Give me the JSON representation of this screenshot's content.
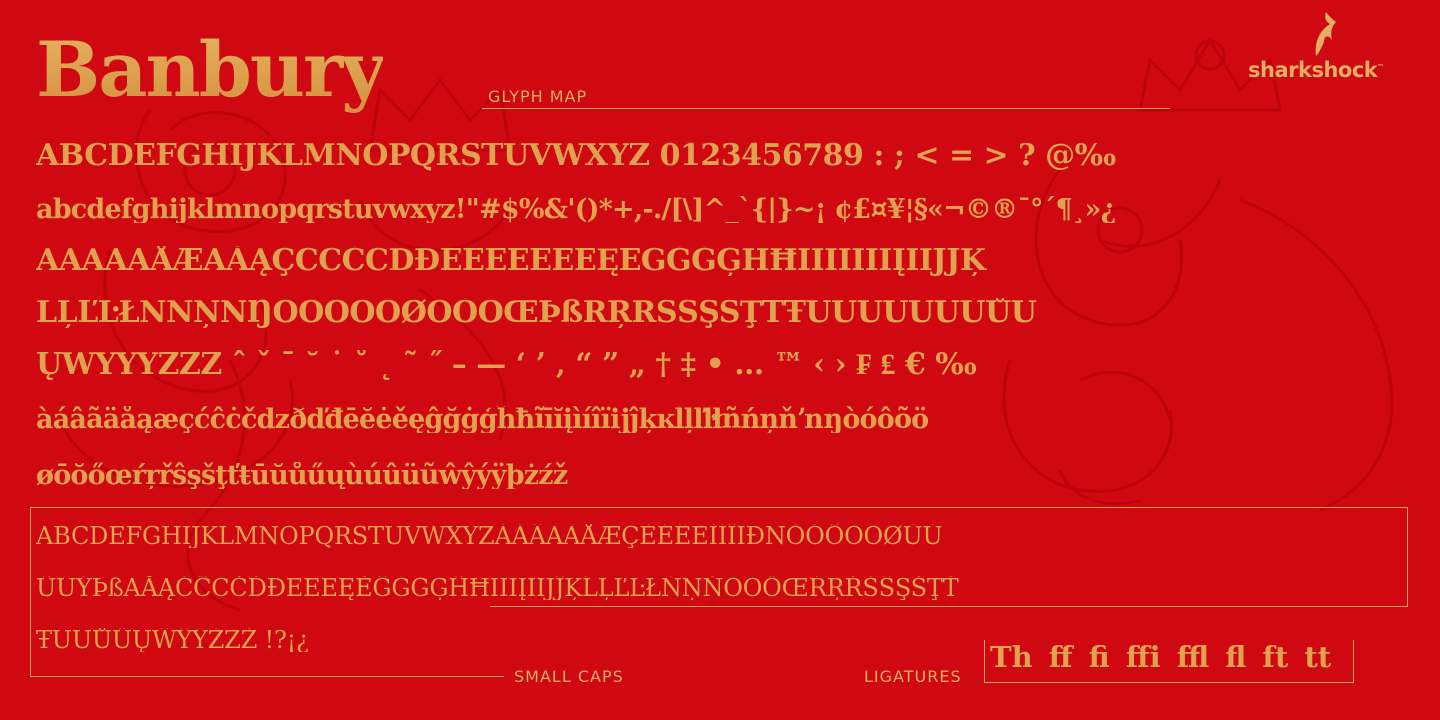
{
  "title": "Banbury",
  "glyph_map_label": "GLYPH MAP",
  "logo_text": "sharkshock",
  "logo_tm": "™",
  "rows": {
    "upper": "ABCDEFGHIJKLMNOPQRSTUVWXYZ 0123456789 : ; < = > ? @‰",
    "lower": "abcdefghijklmnopqrstuvwxyz!\"#$%&'()*+,-./[\\]^_`{|}~¡ ¢£¤¥¦§«¬©®¯°´¶¸»¿",
    "accent1": "ÀÁÂÃÄÅÆĀĂĄÇĆĈĊČĎĐÈÉÊËĒĔĖĘĚĜĞĠĢĤĦÌÍÎÏĨĪĬĮİIJĴĶ",
    "accent2": "ĹĻĽĿŁÑŃŅŇŊÒÓÔÕÖØŌŎŐŒÞßŔŖŘŚŜŞŠŢŤŦÙÚÛÜŨŪŬŮŰ",
    "accent3": "ŲŴÝŶŸŹŻŽ  ˆ ˇ ˉ ˘ ˙ ˚ ˛ ˜ ˝ – — ‘ ’ ‚ “ ” „ † ‡ • … ™ ‹ › ₣ ₤ € ‰",
    "lower_accent1": "àáâãäåąæçćĉċčdzðďđēĕėěęĝğġģĥħĩīĭįìíîïĳĵķĸĺļľŀłñńņňŉŋòóôõö",
    "lower_accent2": "øōŏőœŕŗřŝşšţťŧūŭůűųùúûüũŵŷýÿþżźž",
    "small_caps1": "ABCDEFGHIJKLMNOPQRSTUVWXYZÀÁÂÃÄÅÆÇÈÉÊËÌÍÎÏÐÑÒÓÔÕÖØÙÚ",
    "small_caps2": "ÛÜÝÞßĀĂĄĆĈĊČĎĐĒĔĖĘĚĜĞĠĢĤĦĨĪĬĮİIJĴĶĹĻĽĿŁŃŅŇŌŎŐŒŔŖŘŚŜŞŠŢŤ",
    "small_caps3": "ŦŪŬŮŰŲŴŶŸŹŻŽ !?¡¿"
  },
  "small_caps_label": "SMALL CAPS",
  "ligatures_label": "LIGATURES",
  "ligatures": "Th ff fi ffi ffl fl ft tt",
  "colors": {
    "background": "#cf0812",
    "gold": "#e1a24f"
  }
}
